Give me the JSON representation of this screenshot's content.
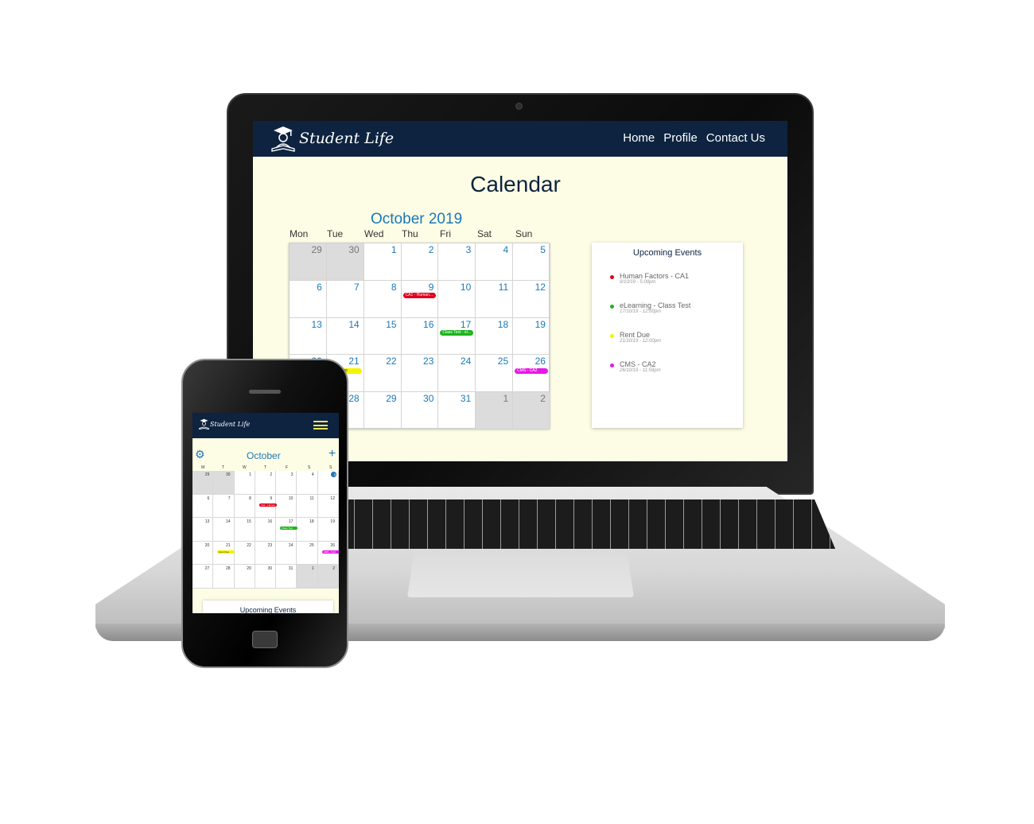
{
  "app": {
    "brand": "Student Life",
    "nav": [
      "Home",
      "Profile",
      "Contact Us"
    ],
    "page_title": "Calendar"
  },
  "colors": {
    "navy": "#0d2340",
    "accent_blue": "#1978b8",
    "page_bg": "#fdfde6",
    "event_red": "#e0001b",
    "event_green": "#1bb51b",
    "event_yellow": "#f4f400",
    "event_magenta": "#e619e6"
  },
  "calendar": {
    "month_title": "October 2019",
    "weekdays": [
      "Mon",
      "Tue",
      "Wed",
      "Thu",
      "Fri",
      "Sat",
      "Sun"
    ],
    "weeks": [
      [
        {
          "d": "29",
          "out": true
        },
        {
          "d": "30",
          "out": true
        },
        {
          "d": "1"
        },
        {
          "d": "2"
        },
        {
          "d": "3"
        },
        {
          "d": "4"
        },
        {
          "d": "5"
        }
      ],
      [
        {
          "d": "6"
        },
        {
          "d": "7"
        },
        {
          "d": "8"
        },
        {
          "d": "9",
          "event": {
            "label": "CA1 - Human...",
            "color": "#e0001b"
          }
        },
        {
          "d": "10"
        },
        {
          "d": "11"
        },
        {
          "d": "12"
        }
      ],
      [
        {
          "d": "13"
        },
        {
          "d": "14"
        },
        {
          "d": "15"
        },
        {
          "d": "16"
        },
        {
          "d": "17",
          "event": {
            "label": "Class Test - el...",
            "color": "#1bb51b"
          }
        },
        {
          "d": "18"
        },
        {
          "d": "19"
        }
      ],
      [
        {
          "d": "20"
        },
        {
          "d": "21",
          "event": {
            "label": "Rent Due",
            "color": "#f4f400"
          }
        },
        {
          "d": "22"
        },
        {
          "d": "23"
        },
        {
          "d": "24"
        },
        {
          "d": "25"
        },
        {
          "d": "26",
          "event": {
            "label": "CMS - CA2",
            "color": "#e619e6"
          }
        }
      ],
      [
        {
          "d": "27"
        },
        {
          "d": "28"
        },
        {
          "d": "29"
        },
        {
          "d": "30"
        },
        {
          "d": "31"
        },
        {
          "d": "1",
          "out": true
        },
        {
          "d": "2",
          "out": true
        }
      ]
    ]
  },
  "upcoming": {
    "title": "Upcoming Events",
    "items": [
      {
        "name": "Human Factors - CA1",
        "date": "9/10/19 - 5:00pm",
        "color": "#e0001b"
      },
      {
        "name": "eLearning - Class Test",
        "date": "17/10/19 - 12:00pm",
        "color": "#1bb51b"
      },
      {
        "name": "Rent Due",
        "date": "21/10/19 - 12:00pm",
        "color": "#f4f400"
      },
      {
        "name": "CMS - CA2",
        "date": "26/10/19 - 11:59pm",
        "color": "#e619e6"
      }
    ]
  },
  "mobile": {
    "brand": "Student Life",
    "month_title": "October",
    "weekdays": [
      "M",
      "T",
      "W",
      "T",
      "F",
      "S",
      "S"
    ],
    "today": "6",
    "weeks": [
      [
        {
          "d": "29",
          "out": true
        },
        {
          "d": "30",
          "out": true
        },
        {
          "d": "1"
        },
        {
          "d": "2"
        },
        {
          "d": "3"
        },
        {
          "d": "4"
        },
        {
          "d": "6",
          "today": true
        }
      ],
      [
        {
          "d": "6"
        },
        {
          "d": "7"
        },
        {
          "d": "8"
        },
        {
          "d": "9",
          "event": {
            "label": "CA1 - Human",
            "color": "#e0001b"
          }
        },
        {
          "d": "10"
        },
        {
          "d": "11"
        },
        {
          "d": "12"
        }
      ],
      [
        {
          "d": "13"
        },
        {
          "d": "14"
        },
        {
          "d": "15"
        },
        {
          "d": "16"
        },
        {
          "d": "17",
          "event": {
            "label": "Class Test",
            "color": "#1bb51b"
          }
        },
        {
          "d": "18"
        },
        {
          "d": "19"
        }
      ],
      [
        {
          "d": "20"
        },
        {
          "d": "21",
          "event": {
            "label": "Rent Due",
            "color": "#f4f400"
          }
        },
        {
          "d": "22"
        },
        {
          "d": "23"
        },
        {
          "d": "24"
        },
        {
          "d": "25"
        },
        {
          "d": "26",
          "event": {
            "label": "CMS - CA2",
            "color": "#e619e6"
          }
        }
      ],
      [
        {
          "d": "27"
        },
        {
          "d": "28"
        },
        {
          "d": "29"
        },
        {
          "d": "30"
        },
        {
          "d": "31"
        },
        {
          "d": "1",
          "out": true
        },
        {
          "d": "2",
          "out": true
        }
      ]
    ],
    "upcoming_title": "Upcoming Events"
  }
}
